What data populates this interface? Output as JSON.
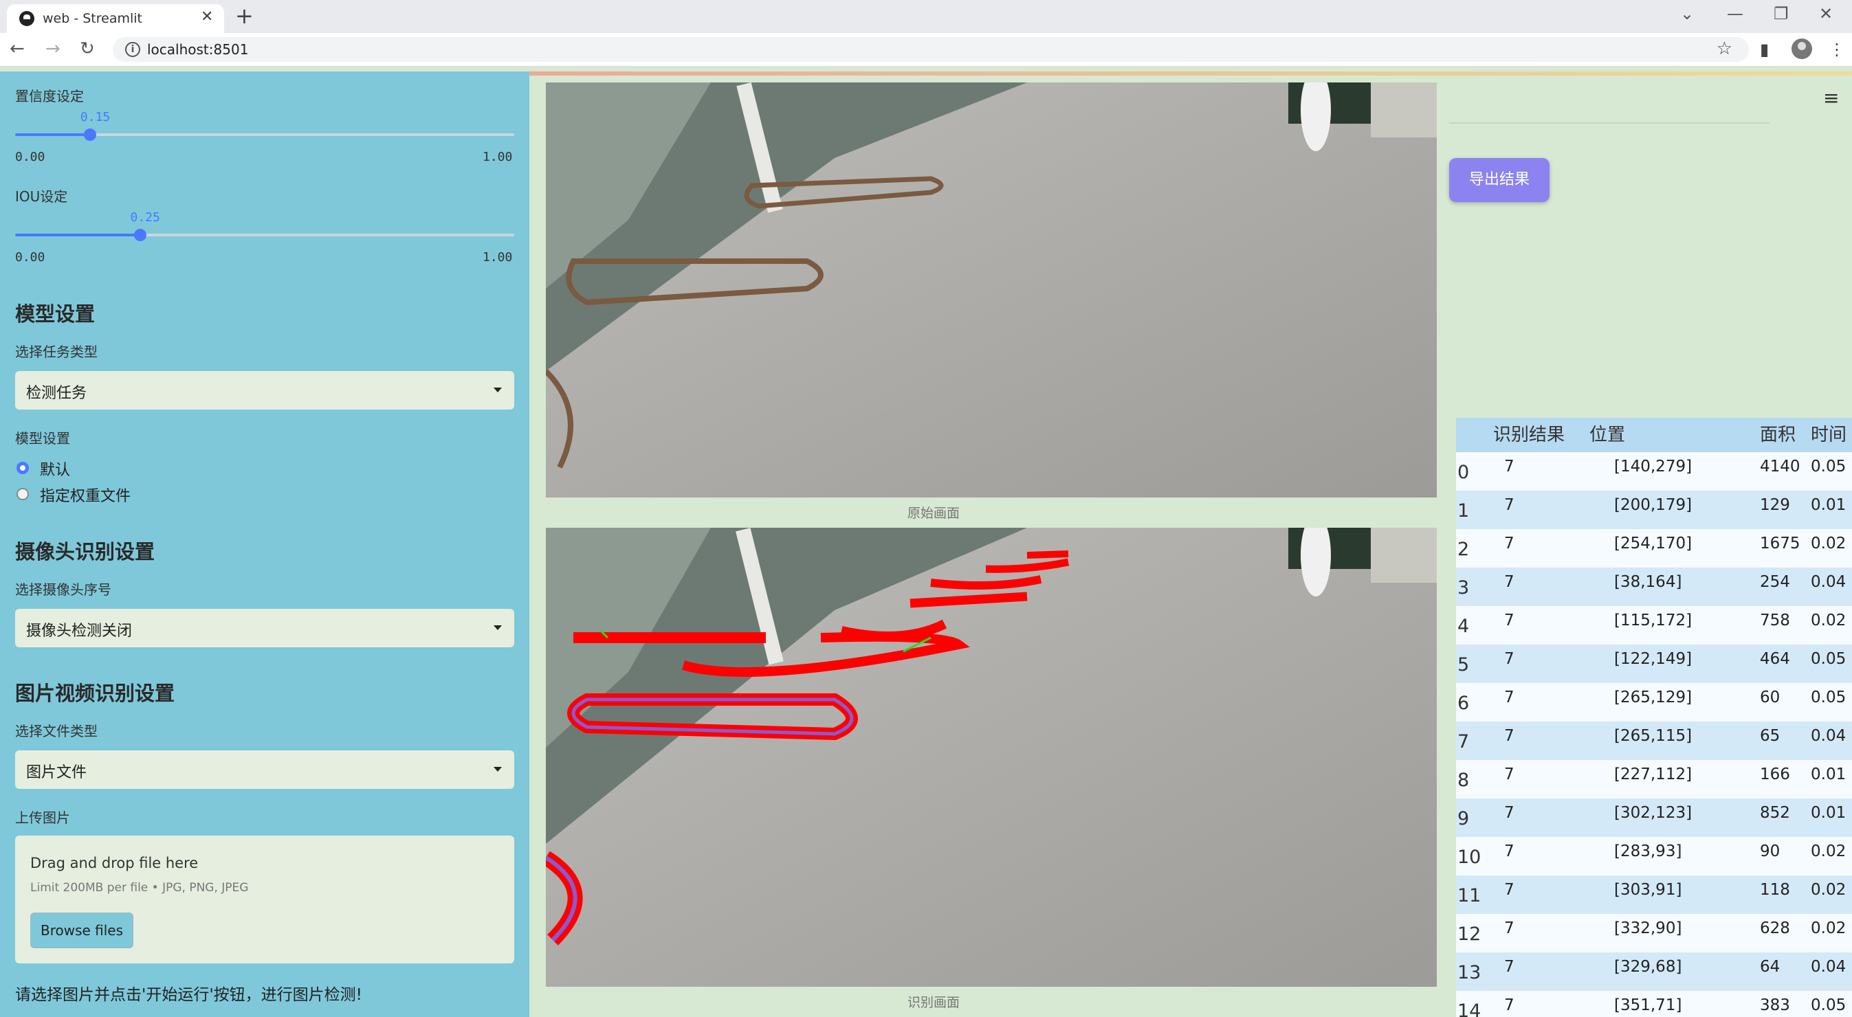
{
  "browser": {
    "tab_title": "web - Streamlit",
    "url": "localhost:8501"
  },
  "sidebar": {
    "confidence": {
      "label": "置信度设定",
      "value": "0.15",
      "min": "0.00",
      "max": "1.00",
      "fraction": 0.15
    },
    "iou": {
      "label": "IOU设定",
      "value": "0.25",
      "min": "0.00",
      "max": "1.00",
      "fraction": 0.25
    },
    "model_section_title": "模型设置",
    "task_type_label": "选择任务类型",
    "task_type_value": "检测任务",
    "model_label": "模型设置",
    "model_options": [
      "默认",
      "指定权重文件"
    ],
    "model_selected": 0,
    "camera_section_title": "摄像头识别设置",
    "camera_label": "选择摄像头序号",
    "camera_value": "摄像头检测关闭",
    "media_section_title": "图片视频识别设置",
    "file_type_label": "选择文件类型",
    "file_type_value": "图片文件",
    "upload_label": "上传图片",
    "upload_drop_text": "Drag and drop file here",
    "upload_limit": "Limit 200MB per file • JPG, PNG, JPEG",
    "browse_button": "Browse files",
    "hint": "请选择图片并点击'开始运行'按钮，进行图片检测!"
  },
  "main": {
    "original_caption": "原始画面",
    "result_caption": "识别画面",
    "export_button": "导出结果",
    "table": {
      "columns": [
        "识别结果",
        "位置",
        "面积",
        "时间"
      ],
      "rows": [
        [
          "0",
          "7",
          "[140,279]",
          "4140",
          "0.05"
        ],
        [
          "1",
          "7",
          "[200,179]",
          "129",
          "0.01"
        ],
        [
          "2",
          "7",
          "[254,170]",
          "1675",
          "0.02"
        ],
        [
          "3",
          "7",
          "[38,164]",
          "254",
          "0.04"
        ],
        [
          "4",
          "7",
          "[115,172]",
          "758",
          "0.02"
        ],
        [
          "5",
          "7",
          "[122,149]",
          "464",
          "0.05"
        ],
        [
          "6",
          "7",
          "[265,129]",
          "60",
          "0.05"
        ],
        [
          "7",
          "7",
          "[265,115]",
          "65",
          "0.04"
        ],
        [
          "8",
          "7",
          "[227,112]",
          "166",
          "0.01"
        ],
        [
          "9",
          "7",
          "[302,123]",
          "852",
          "0.01"
        ],
        [
          "10",
          "7",
          "[283,93]",
          "90",
          "0.02"
        ],
        [
          "11",
          "7",
          "[303,91]",
          "118",
          "0.02"
        ],
        [
          "12",
          "7",
          "[332,90]",
          "628",
          "0.02"
        ],
        [
          "13",
          "7",
          "[329,68]",
          "64",
          "0.04"
        ],
        [
          "14",
          "7",
          "[351,71]",
          "383",
          "0.05"
        ]
      ]
    }
  }
}
